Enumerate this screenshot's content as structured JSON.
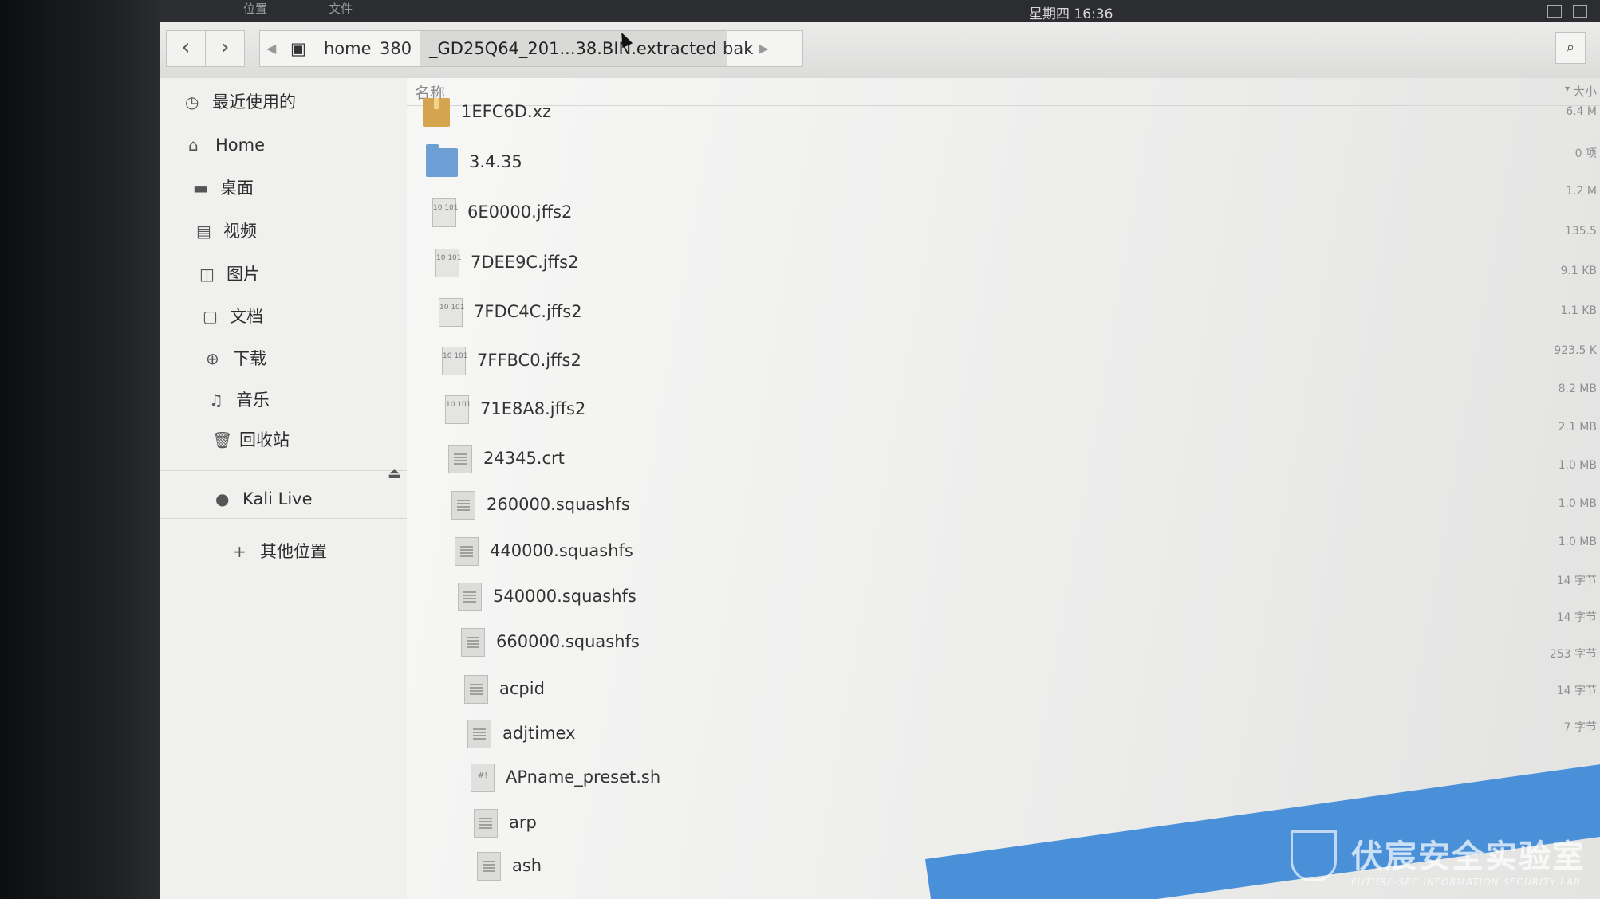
{
  "topbar": {
    "menu_places": "位置",
    "menu_files": "文件",
    "clock": "星期四 16:36"
  },
  "toolbar": {
    "back_icon": "chevron-left-icon",
    "forward_icon": "chevron-right-icon",
    "breadcrumbs": [
      "home",
      "380",
      "_GD25Q64_201...38.BIN.extracted",
      "bak"
    ],
    "search_icon": "search-icon"
  },
  "sidebar": {
    "items": [
      {
        "label": "最近使用的",
        "icon": "clock-icon"
      },
      {
        "label": "Home",
        "icon": "home-icon"
      },
      {
        "label": "桌面",
        "icon": "desktop-folder-icon"
      },
      {
        "label": "视频",
        "icon": "film-icon"
      },
      {
        "label": "图片",
        "icon": "image-icon"
      },
      {
        "label": "文档",
        "icon": "document-icon"
      },
      {
        "label": "下载",
        "icon": "download-icon"
      },
      {
        "label": "音乐",
        "icon": "music-icon"
      },
      {
        "label": "回收站",
        "icon": "trash-icon"
      },
      {
        "label": "Kali Live",
        "icon": "disc-icon"
      },
      {
        "label": "其他位置",
        "icon": "plus-icon"
      }
    ]
  },
  "content": {
    "column_name": "名称",
    "column_size": "大小",
    "files": [
      {
        "name": "1EFC6D.xz",
        "type": "archive",
        "size": "6.4 M"
      },
      {
        "name": "3.4.35",
        "type": "folder",
        "size": "0 项"
      },
      {
        "name": "6E0000.jffs2",
        "type": "binary",
        "size": "1.2 M"
      },
      {
        "name": "7DEE9C.jffs2",
        "type": "binary",
        "size": "135.5"
      },
      {
        "name": "7FDC4C.jffs2",
        "type": "binary",
        "size": "9.1 KB"
      },
      {
        "name": "7FFBC0.jffs2",
        "type": "binary",
        "size": "1.1 KB"
      },
      {
        "name": "71E8A8.jffs2",
        "type": "binary",
        "size": "923.5 K"
      },
      {
        "name": "24345.crt",
        "type": "text",
        "size": "8.2 MB"
      },
      {
        "name": "260000.squashfs",
        "type": "text",
        "size": "2.1 MB"
      },
      {
        "name": "440000.squashfs",
        "type": "text",
        "size": "1.0 MB"
      },
      {
        "name": "540000.squashfs",
        "type": "text",
        "size": "1.0 MB"
      },
      {
        "name": "660000.squashfs",
        "type": "text",
        "size": "1.0 MB"
      },
      {
        "name": "acpid",
        "type": "text",
        "size": "14 字节"
      },
      {
        "name": "adjtimex",
        "type": "text",
        "size": "14 字节"
      },
      {
        "name": "APname_preset.sh",
        "type": "script",
        "size": "253 字节"
      },
      {
        "name": "arp",
        "type": "text",
        "size": "14 字节"
      },
      {
        "name": "ash",
        "type": "text",
        "size": "7 字节"
      }
    ]
  },
  "watermark": {
    "title": "伏宸安全实验室",
    "subtitle": "FUTURE-SEC INFORMATION SECURITY LAB"
  }
}
